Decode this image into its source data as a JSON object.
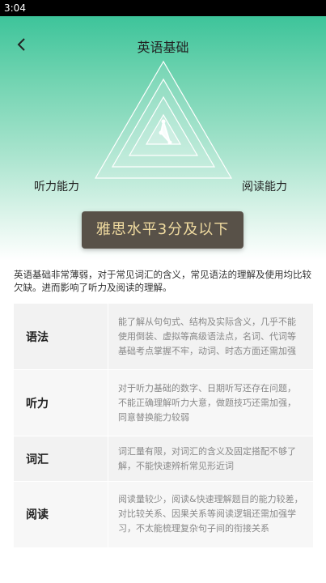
{
  "status_bar": {
    "time": "3:04"
  },
  "header": {
    "title": "英语基础",
    "back_icon": "chevron-left-icon"
  },
  "hero": {
    "left_label": "听力能力",
    "right_label": "阅读能力",
    "level_badge": "雅思水平3分及以下"
  },
  "summary": "英语基础非常薄弱，对于常见词汇的含义，常见语法的理解及使用均比较欠缺。进而影响了听力及阅读的理解。",
  "skills": [
    {
      "name": "语法",
      "description": "能了解从句句式、结构及实际含义，几乎不能使用倒装、虚拟等高级语法点，名词、代词等基础考点掌握不牢，动词、时态方面还需加强"
    },
    {
      "name": "听力",
      "description": "对于听力基础的数字、日期听写还存在问题，不能正确理解听力大意，做题技巧还需加强，同意替换能力较弱"
    },
    {
      "name": "词汇",
      "description": "词汇量有限，对词汇的含义及固定搭配不够了解，不能快速辨析常见形近词"
    },
    {
      "name": "阅读",
      "description": "阅读量较少，阅读&快速理解题目的能力较差，对比较关系、因果关系等阅读逻辑还需加强学习，不太能梳理复杂句子间的衔接关系"
    }
  ]
}
